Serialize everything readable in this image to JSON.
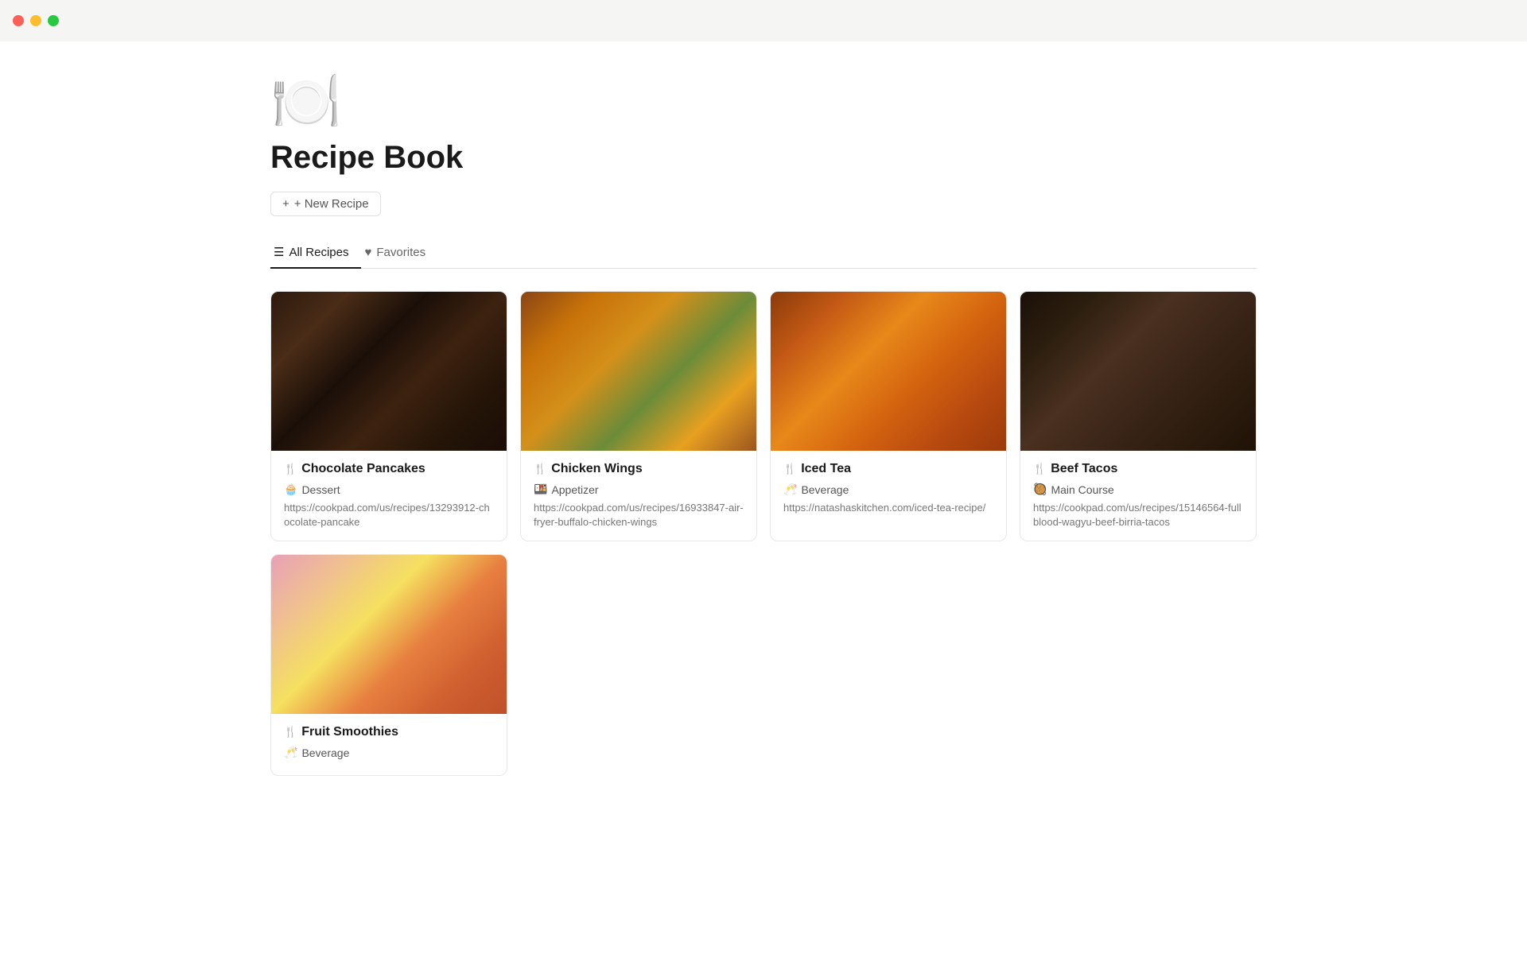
{
  "titlebar": {
    "traffic_lights": [
      "red",
      "yellow",
      "green"
    ]
  },
  "page": {
    "icon": "🍽️",
    "title": "Recipe Book",
    "new_recipe_label": "+ New Recipe"
  },
  "tabs": [
    {
      "id": "all-recipes",
      "label": "All Recipes",
      "icon": "≡",
      "active": true
    },
    {
      "id": "favorites",
      "label": "Favorites",
      "icon": "♥",
      "active": false
    }
  ],
  "recipes": [
    {
      "id": "chocolate-pancakes",
      "name": "Chocolate Pancakes",
      "name_icon": "🍴",
      "category": "Dessert",
      "category_icon": "🧁",
      "url": "https://cookpad.com/us/recipes/13293912-chocolate-pancake",
      "image_class": "img-chocolate"
    },
    {
      "id": "chicken-wings",
      "name": "Chicken Wings",
      "name_icon": "🍴",
      "category": "Appetizer",
      "category_icon": "🍱",
      "url": "https://cookpad.com/us/recipes/16933847-air-fryer-buffalo-chicken-wings",
      "image_class": "img-chicken"
    },
    {
      "id": "iced-tea",
      "name": "Iced Tea",
      "name_icon": "🍴",
      "category": "Beverage",
      "category_icon": "🥂",
      "url": "https://natashaskitchen.com/iced-tea-recipe/",
      "image_class": "img-icedtea"
    },
    {
      "id": "beef-tacos",
      "name": "Beef Tacos",
      "name_icon": "🍴",
      "category": "Main Course",
      "category_icon": "🥘",
      "url": "https://cookpad.com/us/recipes/15146564-fullblood-wagyu-beef-birria-tacos",
      "image_class": "img-beeftacos"
    },
    {
      "id": "fruit-smoothies",
      "name": "Fruit Smoothies",
      "name_icon": "🍴",
      "category": "Beverage",
      "category_icon": "🥂",
      "url": "",
      "image_class": "img-smoothies"
    }
  ]
}
